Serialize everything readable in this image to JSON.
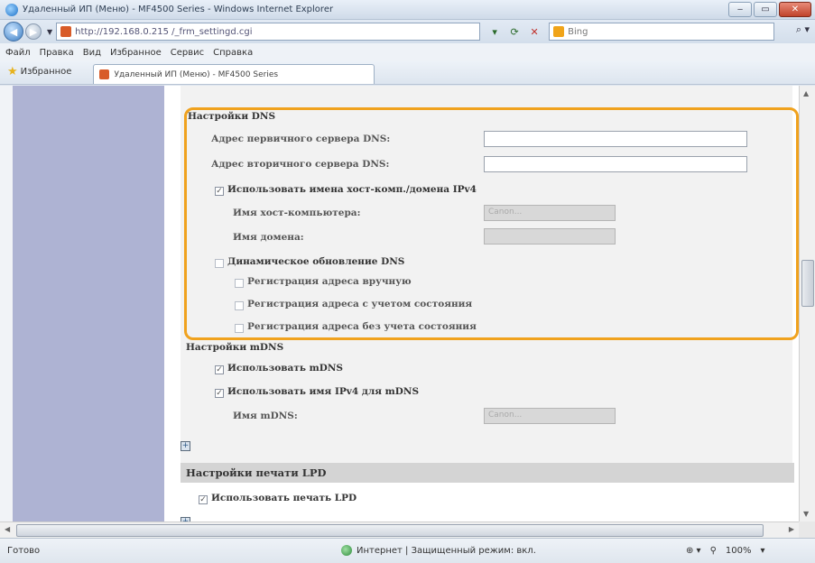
{
  "window": {
    "title": "Удаленный ИП (Меню) - MF4500 Series - Windows Internet Explorer",
    "minimize": "‒",
    "maximize": "▭",
    "close": "✕"
  },
  "address_bar": {
    "url": "http://192.168.0.215 /_frm_settingd.cgi",
    "search_provider": "Bing"
  },
  "menu": [
    "Файл",
    "Правка",
    "Вид",
    "Избранное",
    "Сервис",
    "Справка"
  ],
  "favorites": {
    "label": "Избранное",
    "tab_title": "Удаленный ИП (Меню) - MF4500 Series"
  },
  "dns": {
    "heading": "Настройки DNS",
    "primary_label": "Адрес первичного сервера DNS:",
    "primary_value": "",
    "secondary_label": "Адрес вторичного сервера DNS:",
    "secondary_value": "",
    "use_host_domain_label": "Использовать имена хост-комп./домена IPv4",
    "use_host_domain_checked": true,
    "host_name_label": "Имя хост-компьютера:",
    "host_name_value": "Canon...",
    "domain_label": "Имя домена:",
    "domain_value": "",
    "dynamic_update_label": "Динамическое обновление DNS",
    "dynamic_update_checked": false,
    "manual_reg_label": "Регистрация адреса вручную",
    "stateful_reg_label": "Регистрация адреса с учетом состояния",
    "stateless_reg_label": "Регистрация адреса без учета состояния"
  },
  "mdns": {
    "heading": "Настройки mDNS",
    "use_mdns_label": "Использовать mDNS",
    "use_mdns_checked": true,
    "use_ipv4_name_label": "Использовать имя IPv4 для mDNS",
    "use_ipv4_name_checked": true,
    "mdns_name_label": "Имя mDNS:",
    "mdns_name_value": "Canon..."
  },
  "lpd": {
    "heading": "Настройки печати LPD",
    "use_lpd_label": "Использовать печать LPD",
    "use_lpd_checked": true
  },
  "status": {
    "ready": "Готово",
    "zone": "Интернет | Защищенный режим: вкл.",
    "zoom": "100%"
  },
  "colors": {
    "highlight": "#f0a21e",
    "sidebar": "#aeb3d3"
  }
}
